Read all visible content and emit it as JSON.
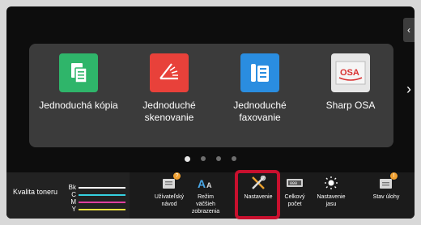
{
  "tiles": [
    {
      "label": "Jednoduchá kópia",
      "icon": "copy-icon",
      "color": "#2fb56a"
    },
    {
      "label": "Jednoduché skenovanie",
      "icon": "scan-icon",
      "color": "#e8413a"
    },
    {
      "label": "Jednoduché faxovanie",
      "icon": "fax-icon",
      "color": "#2a8de0"
    },
    {
      "label": "Sharp OSA",
      "icon": "sharp-osa-icon",
      "color": "#e6e6e6"
    }
  ],
  "pager": {
    "count": 4,
    "active": 0
  },
  "toner": {
    "label": "Kvalita toneru",
    "rows": [
      {
        "key": "Bk",
        "color": "#ffffff"
      },
      {
        "key": "C",
        "color": "#36d0e0"
      },
      {
        "key": "M",
        "color": "#e040a0"
      },
      {
        "key": "Y",
        "color": "#f0e040"
      }
    ]
  },
  "shortcuts": [
    {
      "label": "Užívateľský návod",
      "icon": "user-guide-icon",
      "badge": "?"
    },
    {
      "label": "Režim väčšieh zobrazenia",
      "icon": "large-text-icon"
    },
    {
      "label": "Nastavenie",
      "icon": "settings-tools-icon"
    },
    {
      "label": "Celkový počet",
      "icon": "total-count-icon"
    },
    {
      "label": "Nastavenie jasu",
      "icon": "brightness-icon"
    },
    {
      "label": "Stav úlohy",
      "icon": "job-status-icon",
      "badge": "!"
    }
  ],
  "colors": {
    "highlight": "#c8102e"
  }
}
